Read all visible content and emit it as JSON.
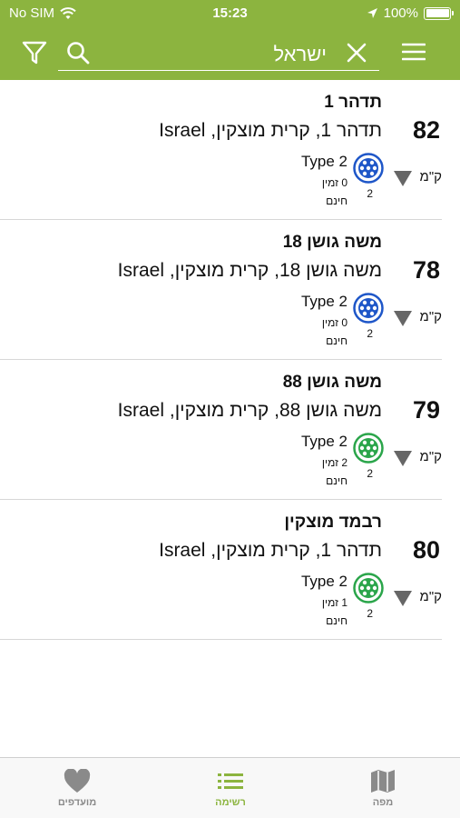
{
  "status_bar": {
    "carrier": "No SIM",
    "time": "15:23",
    "battery": "100%"
  },
  "search": {
    "value": "ישראל"
  },
  "colors": {
    "header": "#8cb43f",
    "connector_blue": "#1e56c8",
    "connector_green": "#2aa54a",
    "tab_active": "#8cb43f",
    "tab_inactive": "#8a8a8a"
  },
  "stations": [
    {
      "title": "תדהר 1",
      "address": "תדהר 1, קרית מוצקין, Israel",
      "distance": "82",
      "unit": "ק\"מ",
      "connector": "Type 2",
      "availability": "0 זמין",
      "count": "2",
      "price": "חינם",
      "connector_color": "blue"
    },
    {
      "title": "משה גושן 18",
      "address": "משה גושן 18, קרית מוצקין, Israel",
      "distance": "78",
      "unit": "ק\"מ",
      "connector": "Type 2",
      "availability": "0 זמין",
      "count": "2",
      "price": "חינם",
      "connector_color": "blue"
    },
    {
      "title": "משה גושן 88",
      "address": "משה גושן 88, קרית מוצקין, Israel",
      "distance": "79",
      "unit": "ק\"מ",
      "connector": "Type 2",
      "availability": "2 זמין",
      "count": "2",
      "price": "חינם",
      "connector_color": "green"
    },
    {
      "title": "רבמד מוצקין",
      "address": "תדהר 1, קרית מוצקין, Israel",
      "distance": "80",
      "unit": "ק\"מ",
      "connector": "Type 2",
      "availability": "1 זמין",
      "count": "2",
      "price": "חינם",
      "connector_color": "green"
    }
  ],
  "tabs": [
    {
      "label": "מועדפים",
      "icon": "heart-icon",
      "active": false
    },
    {
      "label": "רשימה",
      "icon": "list-icon",
      "active": true
    },
    {
      "label": "מפה",
      "icon": "map-icon",
      "active": false
    }
  ]
}
